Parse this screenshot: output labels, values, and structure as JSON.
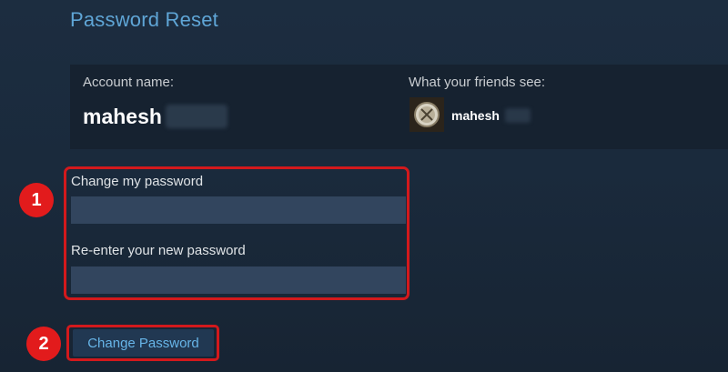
{
  "page": {
    "title": "Password Reset"
  },
  "account": {
    "account_label": "Account name:",
    "account_name": "mahesh",
    "friends_label": "What your friends see:",
    "friend_display_name": "mahesh"
  },
  "form": {
    "new_password_label": "Change my password",
    "new_password_value": "",
    "confirm_password_label": "Re-enter your new password",
    "confirm_password_value": "",
    "submit_label": "Change Password"
  },
  "annotations": {
    "marker_1": "1",
    "marker_2": "2",
    "highlight_color": "#d3191c"
  },
  "colors": {
    "title": "#5fa5d6",
    "input_bg": "#32455e",
    "button_text": "#67b5e8"
  }
}
